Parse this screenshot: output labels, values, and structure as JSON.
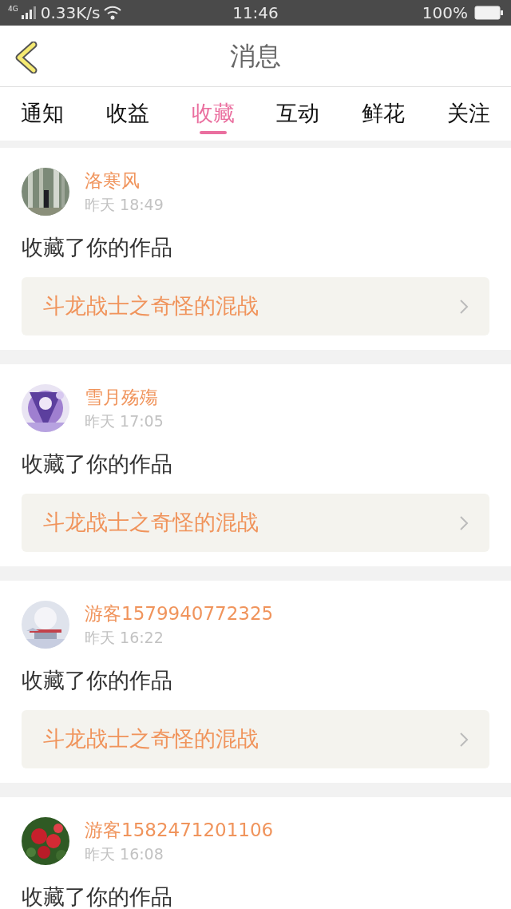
{
  "status_bar": {
    "network": "4G",
    "speed": "0.33K/s",
    "time": "11:46",
    "battery": "100%"
  },
  "header": {
    "title": "消息"
  },
  "tabs": [
    {
      "label": "通知",
      "selected": false
    },
    {
      "label": "收益",
      "selected": false
    },
    {
      "label": "收藏",
      "selected": true
    },
    {
      "label": "互动",
      "selected": false
    },
    {
      "label": "鲜花",
      "selected": false
    },
    {
      "label": "关注",
      "selected": false
    }
  ],
  "messages": [
    {
      "user": "洛寒风",
      "time": "昨天 18:49",
      "action": "收藏了你的作品",
      "work": "斗龙战士之奇怪的混战"
    },
    {
      "user": "雪月殇殤",
      "time": "昨天 17:05",
      "action": "收藏了你的作品",
      "work": "斗龙战士之奇怪的混战"
    },
    {
      "user": "游客1579940772325",
      "time": "昨天 16:22",
      "action": "收藏了你的作品",
      "work": "斗龙战士之奇怪的混战"
    },
    {
      "user": "游客1582471201106",
      "time": "昨天 16:08",
      "action": "收藏了你的作品"
    }
  ]
}
